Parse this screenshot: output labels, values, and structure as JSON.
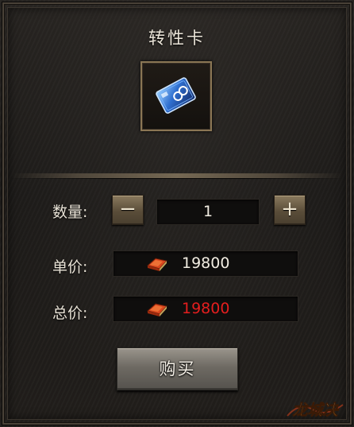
{
  "dialog": {
    "title": "转性卡"
  },
  "item": {
    "icon": "blue-gender-swap-card-icon"
  },
  "quantity": {
    "label": "数量:",
    "value": "1",
    "decrement": "−",
    "increment": "+"
  },
  "unit_price": {
    "label": "单价:",
    "value": "19800",
    "currency_icon": "gold-ingot-currency-icon"
  },
  "total_price": {
    "label": "总价:",
    "value": "19800",
    "currency_icon": "gold-ingot-currency-icon",
    "value_color": "#e41e1e"
  },
  "actions": {
    "buy_label": "购买"
  },
  "brand": {
    "logo_text": "龙城决"
  },
  "colors": {
    "panel_bg": "#211e1b",
    "frame_gold": "#8a7654",
    "text_light": "#e8e2d6"
  }
}
